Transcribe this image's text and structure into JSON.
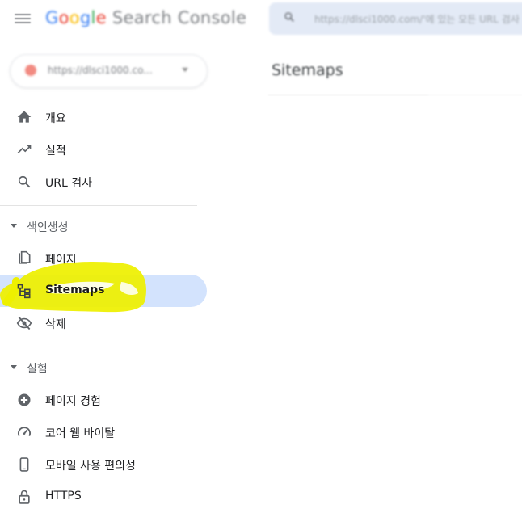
{
  "header": {
    "brand_google": "Google",
    "brand_rest": " Search Console",
    "search_placeholder": "https://dlsci1000.com/'에 있는 모든 URL 검사"
  },
  "property": {
    "label": "https://dlsci1000.co..."
  },
  "main": {
    "title": "Sitemaps"
  },
  "nav": {
    "overview": "개요",
    "performance": "실적",
    "url_inspection": "URL 검사",
    "indexing_section": "색인생성",
    "pages": "페이지",
    "sitemaps": "Sitemaps",
    "removals": "삭제",
    "experience_section": "실험",
    "page_experience": "페이지 경험",
    "core_web_vitals": "코어 웹 바이탈",
    "mobile_usability": "모바일 사용 편의성",
    "https": "HTTPS"
  },
  "colors": {
    "active_bg": "#d3e3fd",
    "highlight": "#eef000",
    "icon": "#5f6368"
  },
  "icons": [
    "menu-icon",
    "search-icon",
    "home-icon",
    "trending-up-icon",
    "magnifier-icon",
    "file-copy-icon",
    "sitemap-icon",
    "eye-off-icon",
    "plus-circle-icon",
    "gauge-icon",
    "phone-icon",
    "lock-icon"
  ]
}
